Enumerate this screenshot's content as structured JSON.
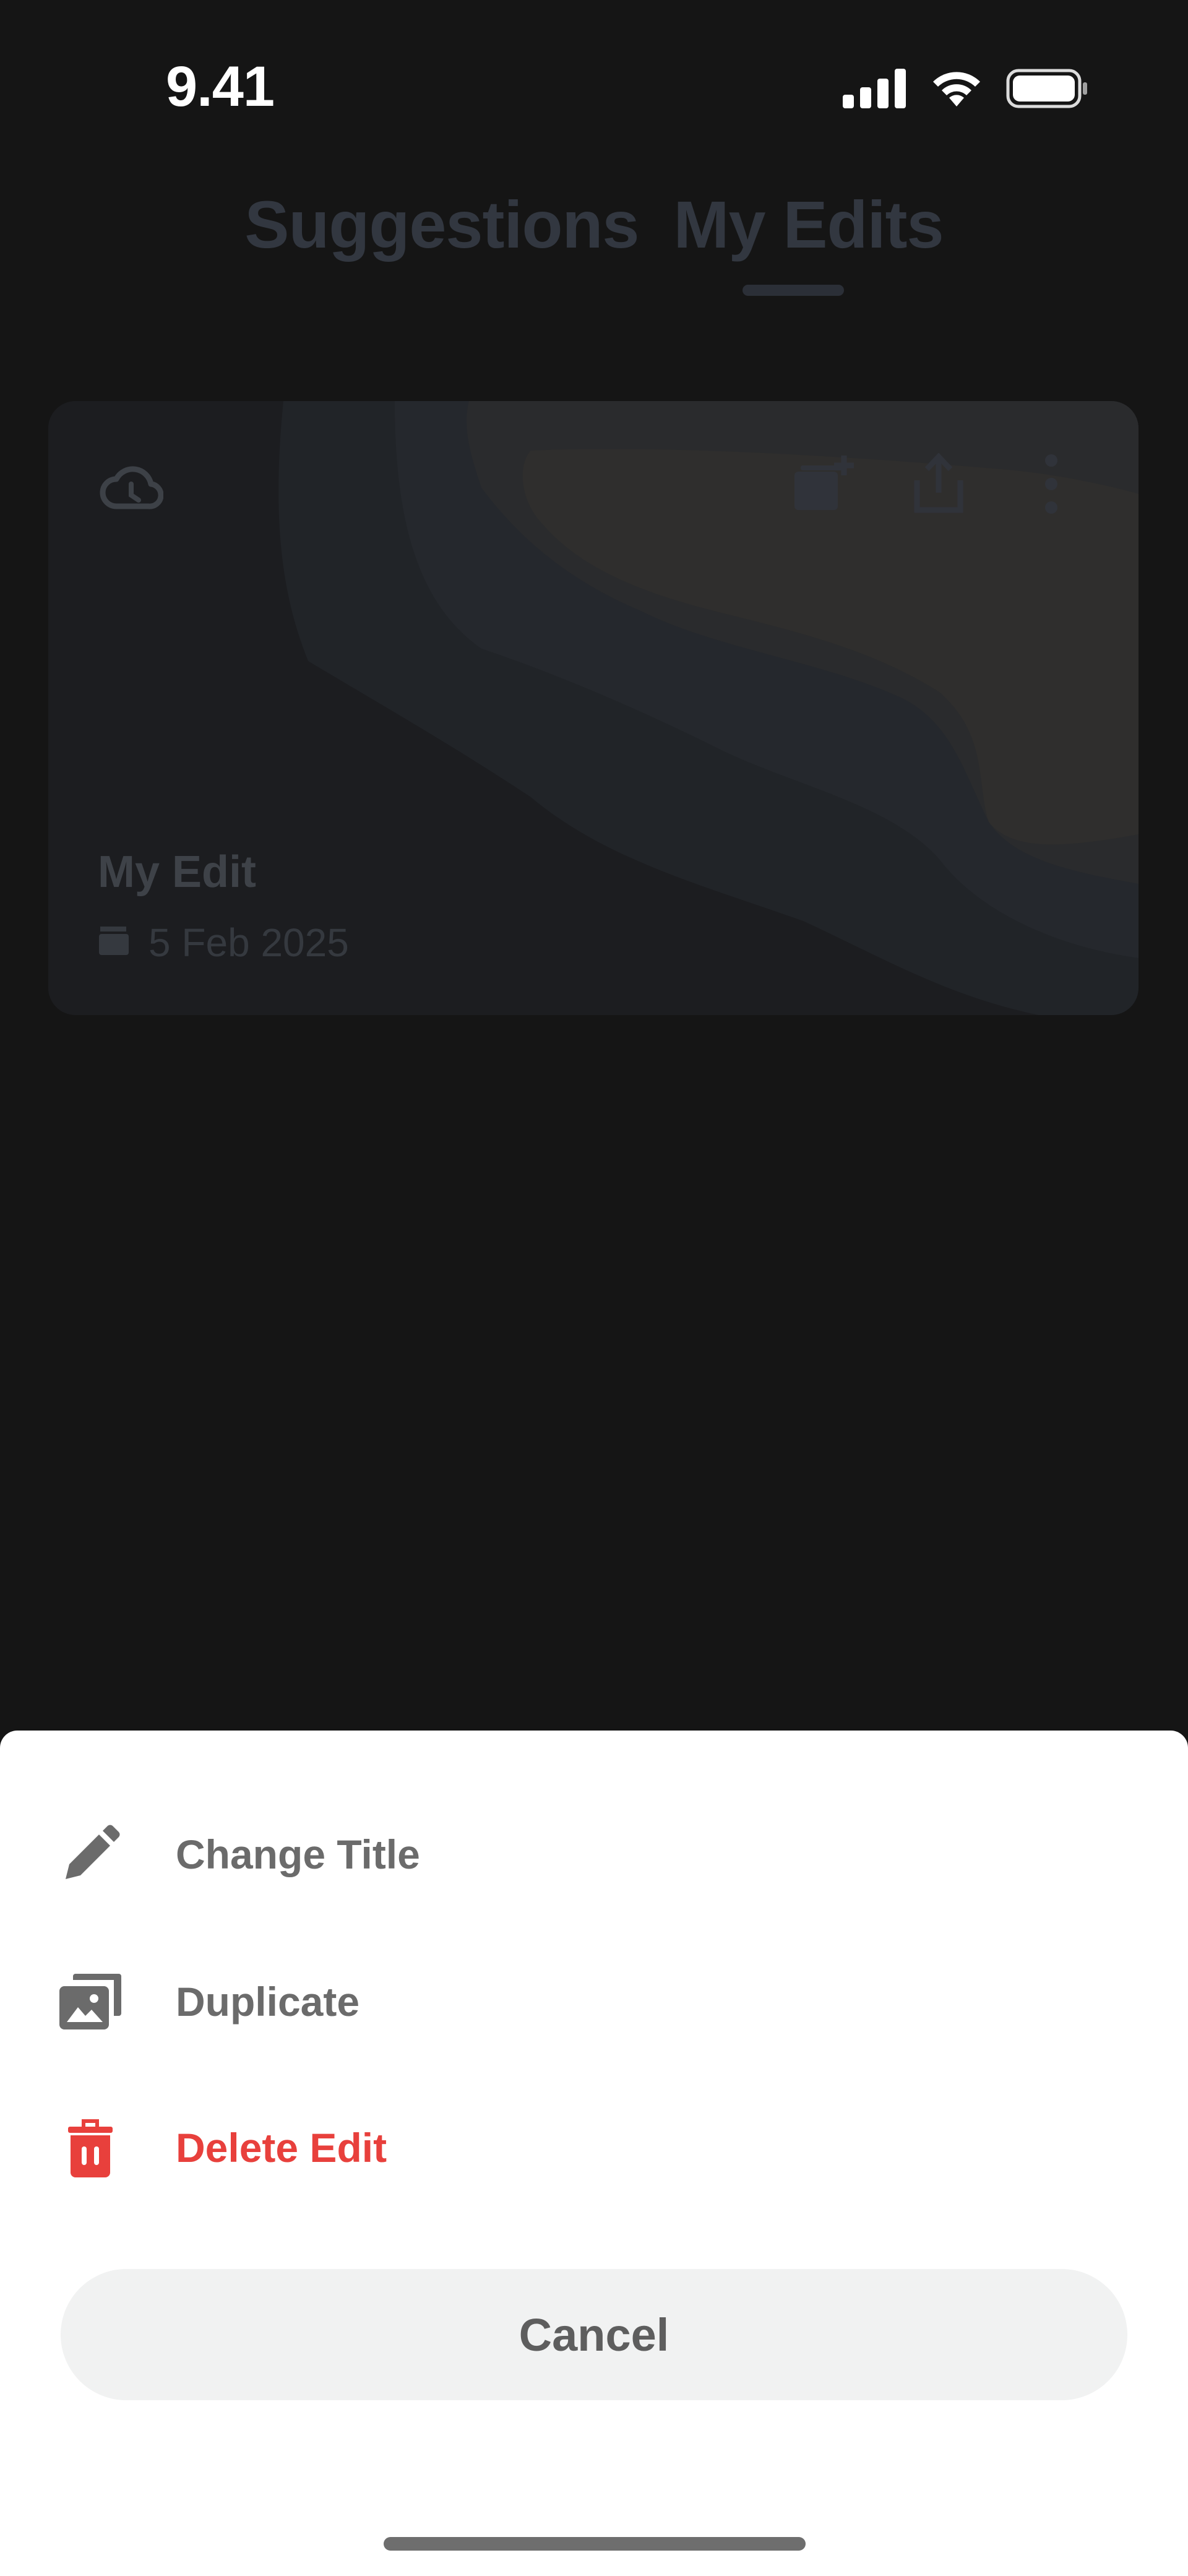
{
  "status_bar": {
    "time": "9.41",
    "icons": [
      "cellular-signal-icon",
      "wifi-icon",
      "battery-icon"
    ]
  },
  "tabs": [
    {
      "label": "Suggestions",
      "active": false
    },
    {
      "label": "My Edits",
      "active": true
    }
  ],
  "edit_card": {
    "title": "My Edit",
    "date": "5 Feb 2025",
    "icons": [
      "cloud-icon",
      "add-to-project-icon",
      "share-icon",
      "more-options-icon",
      "clapperboard-icon"
    ]
  },
  "action_sheet": {
    "items": [
      {
        "label": "Change Title",
        "icon": "pencil-icon",
        "color": "#6b6b6b"
      },
      {
        "label": "Duplicate",
        "icon": "duplicate-icon",
        "color": "#6b6b6b"
      },
      {
        "label": "Delete Edit",
        "icon": "trash-icon",
        "color": "#e8403c"
      }
    ],
    "cancel_label": "Cancel"
  },
  "colors": {
    "background": "#151515",
    "sheet": "#ffffff",
    "danger": "#e8403c",
    "cancel_bg": "#f1f2f2"
  }
}
